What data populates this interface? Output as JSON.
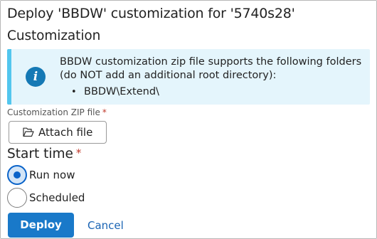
{
  "dialog": {
    "title": "Deploy 'BBDW' customization for '5740s28'"
  },
  "customization": {
    "heading": "Customization",
    "info": {
      "icon": "info-icon",
      "line1": "BBDW customization zip file supports the following folders",
      "line2": "(do NOT add an additional root directory):",
      "folders": [
        "BBDW\\Extend\\"
      ]
    },
    "zip_field": {
      "label": "Customization ZIP file",
      "required_mark": "*",
      "attach_label": "Attach file",
      "attach_icon": "folder-open-icon"
    }
  },
  "start_time": {
    "label": "Start time",
    "required_mark": "*",
    "options": [
      {
        "label": "Run now",
        "checked": true
      },
      {
        "label": "Scheduled",
        "checked": false
      }
    ]
  },
  "actions": {
    "deploy_label": "Deploy",
    "cancel_label": "Cancel"
  },
  "colors": {
    "primary": "#1979c9",
    "info_bg": "#e4f5fc",
    "info_border": "#52c6ee",
    "info_icon": "#1579b5",
    "required": "#c0392b",
    "link": "#1a64b4"
  }
}
